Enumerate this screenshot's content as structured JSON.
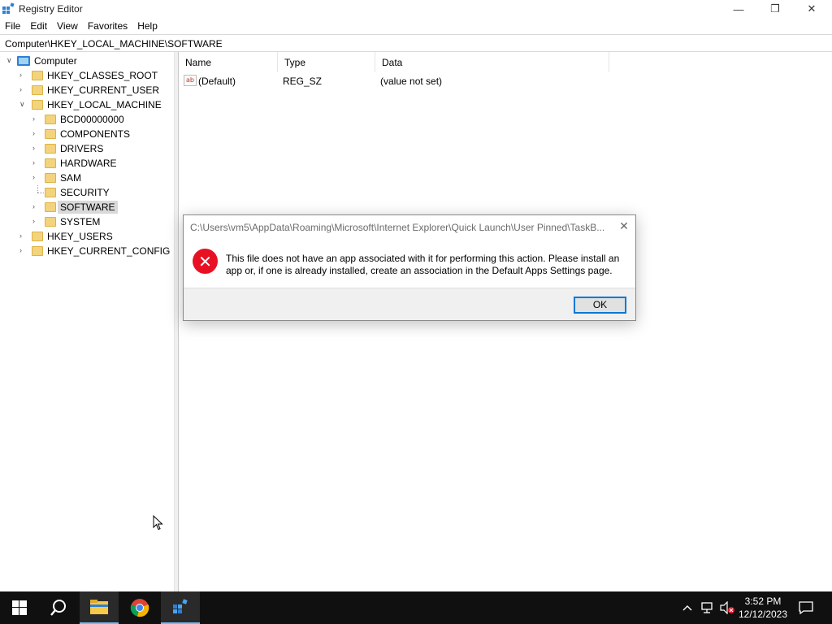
{
  "window": {
    "title": "Registry Editor",
    "minimize_glyph": "—",
    "maximize_glyph": "❐",
    "close_glyph": "✕"
  },
  "menu": [
    "File",
    "Edit",
    "View",
    "Favorites",
    "Help"
  ],
  "address": "Computer\\HKEY_LOCAL_MACHINE\\SOFTWARE",
  "tree": {
    "root": "Computer",
    "hives": [
      "HKEY_CLASSES_ROOT",
      "HKEY_CURRENT_USER",
      "HKEY_LOCAL_MACHINE",
      "HKEY_USERS",
      "HKEY_CURRENT_CONFIG"
    ],
    "hklm_children": [
      "BCD00000000",
      "COMPONENTS",
      "DRIVERS",
      "HARDWARE",
      "SAM",
      "SECURITY",
      "SOFTWARE",
      "SYSTEM"
    ],
    "selected": "SOFTWARE"
  },
  "list": {
    "columns": [
      "Name",
      "Type",
      "Data"
    ],
    "rows": [
      {
        "name": "(Default)",
        "type": "REG_SZ",
        "data": "(value not set)",
        "icon": "string-value-icon"
      }
    ]
  },
  "dialog": {
    "title": "C:\\Users\\vm5\\AppData\\Roaming\\Microsoft\\Internet Explorer\\Quick Launch\\User Pinned\\TaskB...",
    "message": "This file does not have an app associated with it for performing this action. Please install an app or, if one is already installed, create an association in the Default Apps Settings page.",
    "ok_label": "OK",
    "icon": "error-icon"
  },
  "taskbar": {
    "apps": [
      "start-icon",
      "search-icon",
      "file-explorer-icon",
      "chrome-icon",
      "registry-editor-icon"
    ],
    "time": "3:52 PM",
    "date": "12/12/2023"
  },
  "colors": {
    "selection": "#d9d9d9",
    "error_red": "#e81123",
    "accent": "#0078d7",
    "taskbar": "#101010"
  }
}
